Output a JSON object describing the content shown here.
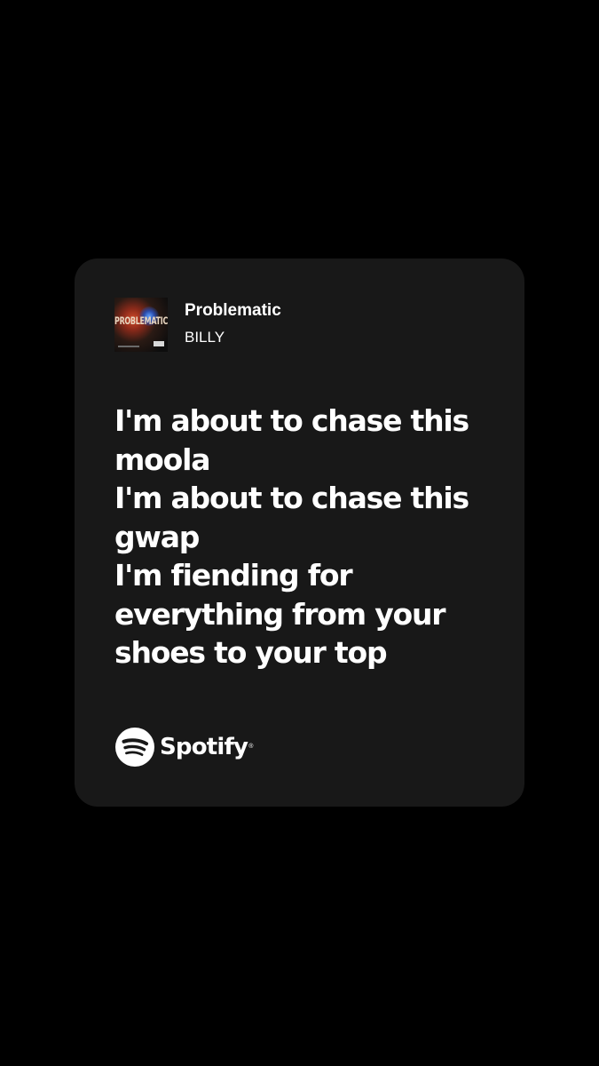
{
  "track": {
    "title": "Problematic",
    "artist": "BILLY",
    "cover_icon": "album-cover",
    "cover_text": "PROBLEMATIC"
  },
  "lyrics": [
    "I'm about to chase this",
    "moola",
    "I'm about to chase this",
    "gwap",
    "I'm fiending for",
    "everything from your",
    "shoes to your top"
  ],
  "brand": {
    "name": "Spotify",
    "icon": "spotify-logo-icon",
    "registered": "®"
  },
  "colors": {
    "background": "#000000",
    "card": "#181818",
    "text": "#ffffff"
  }
}
